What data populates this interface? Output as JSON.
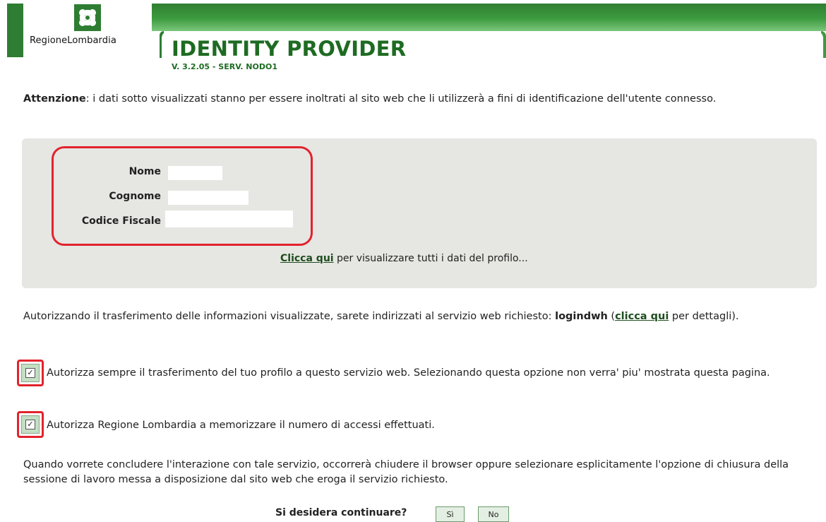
{
  "header": {
    "logo_text": "RegioneLombardia",
    "title": "IDENTITY PROVIDER",
    "version": "V. 3.2.05 - SERV. NODO1"
  },
  "warning": {
    "bold": "Attenzione",
    "text": ": i dati sotto visualizzati stanno per essere inoltrati al sito web che li utilizzerà a fini di identificazione dell'utente connesso."
  },
  "profile": {
    "fields": [
      {
        "label": "Nome",
        "value": ""
      },
      {
        "label": "Cognome",
        "value": ""
      },
      {
        "label": "Codice Fiscale",
        "value": ""
      }
    ],
    "link_label": "Clicca qui",
    "link_suffix": " per visualizzare tutti i dati del profilo..."
  },
  "authorization": {
    "text_before": "Autorizzando il trasferimento delle informazioni visualizzate, sarete indirizzati al servizio web richiesto: ",
    "service_name": "logindwh",
    "paren_open": " (",
    "details_link": "clicca qui",
    "text_after": " per dettagli)."
  },
  "options": [
    {
      "label": "Autorizza sempre il trasferimento del tuo profilo a questo servizio web. Selezionando questa opzione non verra' piu' mostrata questa pagina.",
      "checked": true
    },
    {
      "label": "Autorizza Regione Lombardia a memorizzare il numero di accessi effettuati.",
      "checked": true
    }
  ],
  "closing_text": "Quando vorrete concludere l'interazione con tale servizio, occorrerà chiudere il browser oppure selezionare esplicitamente l'opzione di chiusura della sessione di lavoro messa a disposizione dal sito web che eroga il servizio richiesto.",
  "continue": {
    "question": "Si desidera continuare?",
    "yes_label": "Sì",
    "no_label": "No"
  },
  "colors": {
    "brand_green": "#2e7d32",
    "title_green": "#1e6b22",
    "highlight_red": "#e2232c",
    "panel_gray": "#e6e6e2"
  },
  "icons": {
    "logo": "regione-lombardia-rose-icon",
    "checkbox": "checkmark-icon"
  }
}
